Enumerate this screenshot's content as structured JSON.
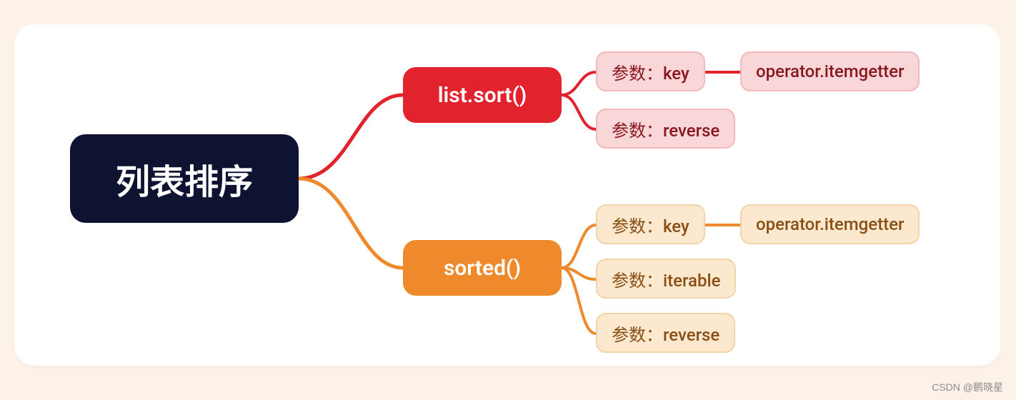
{
  "root": {
    "label": "列表排序"
  },
  "branches": {
    "sort": {
      "label": "list.sort()",
      "color": "#e2232e"
    },
    "sorted": {
      "label": "sorted()",
      "color": "#ee8a2b"
    }
  },
  "leaves": {
    "sort_key": "参数：key",
    "sort_reverse": "参数：reverse",
    "sort_key_ext": "operator.itemgetter",
    "sorted_key": "参数：key",
    "sorted_iter": "参数：iterable",
    "sorted_rev": "参数：reverse",
    "sorted_key_ext": "operator.itemgetter"
  },
  "watermark": "CSDN @鹏晓星",
  "chart_data": {
    "type": "mindmap",
    "root": "列表排序",
    "children": [
      {
        "label": "list.sort()",
        "color": "red",
        "children": [
          {
            "label": "参数：key",
            "children": [
              {
                "label": "operator.itemgetter"
              }
            ]
          },
          {
            "label": "参数：reverse"
          }
        ]
      },
      {
        "label": "sorted()",
        "color": "orange",
        "children": [
          {
            "label": "参数：key",
            "children": [
              {
                "label": "operator.itemgetter"
              }
            ]
          },
          {
            "label": "参数：iterable"
          },
          {
            "label": "参数：reverse"
          }
        ]
      }
    ]
  }
}
